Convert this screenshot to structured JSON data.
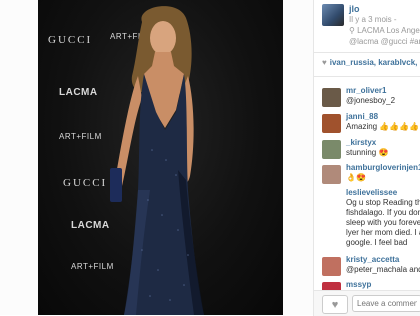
{
  "post": {
    "username": "jlo",
    "time": "Il y a 3 mois -",
    "location": "LACMA Los Angeles",
    "tags": "@lacma @gucci #artandfilm"
  },
  "photo": {
    "backdrop_logos": [
      "GUCCI",
      "ART+FILM",
      "LACMA",
      "ART+FILM",
      "GUCCI",
      "LACMA",
      "ART+FILM"
    ]
  },
  "likes": {
    "users": "ivan_russia, karablvck, ma"
  },
  "comments": [
    {
      "user": "mr_oliver1",
      "text": "@jonesboy_2",
      "avatar_color": "#6a5a48"
    },
    {
      "user": "janni_88",
      "text": "Amazing 👍👍👍👍",
      "avatar_color": "#a0522d"
    },
    {
      "user": "_kirstyx",
      "text": "stunning 😍",
      "avatar_color": "#7a8a6a"
    },
    {
      "user": "hamburgloverinjen187",
      "text": "👌😍",
      "avatar_color": "#b08a7a"
    },
    {
      "user": "leslievelissee",
      "lines": [
        "Og u stop Reading this u",
        "fishdalago. If you don't p",
        "sleep with you forever. Al",
        "lyer her mom died. I am",
        "google. I feel bad"
      ],
      "avatar_color": ""
    },
    {
      "user": "kristy_accetta",
      "text": "@peter_machala and thi",
      "avatar_color": "#c07060"
    },
    {
      "user": "mssyp",
      "text": "",
      "avatar_color": "#c03040"
    }
  ],
  "footer": {
    "comment_placeholder": "Leave a comment..."
  },
  "icons": {
    "location": "pin-icon",
    "likes": "heart-icon",
    "like_button": "heart-icon"
  }
}
